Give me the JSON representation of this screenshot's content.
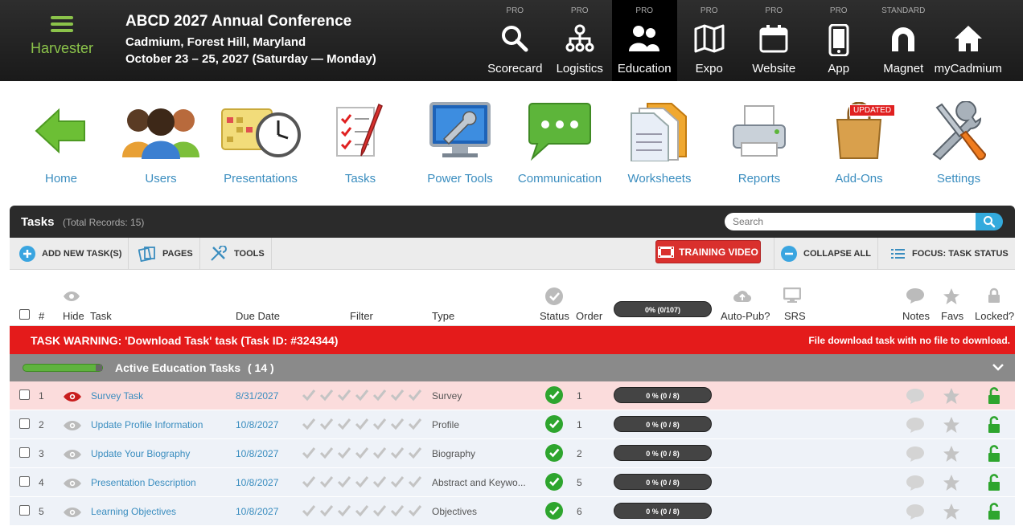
{
  "brand": {
    "name": "Harvester"
  },
  "conference": {
    "title": "ABCD 2027 Annual Conference",
    "location": "Cadmium, Forest Hill, Maryland",
    "dates": "October 23 – 25, 2027 (Saturday — Monday)"
  },
  "modules": [
    {
      "tier": "PRO",
      "label": "Scorecard",
      "icon": "magnifier-icon"
    },
    {
      "tier": "PRO",
      "label": "Logistics",
      "icon": "network-icon"
    },
    {
      "tier": "PRO",
      "label": "Education",
      "icon": "people-icon",
      "active": true
    },
    {
      "tier": "PRO",
      "label": "Expo",
      "icon": "map-icon"
    },
    {
      "tier": "PRO",
      "label": "Website",
      "icon": "calendar-icon"
    },
    {
      "tier": "PRO",
      "label": "App",
      "icon": "phone-icon"
    },
    {
      "tier": "STANDARD",
      "label": "Magnet",
      "icon": "magnet-icon"
    },
    {
      "tier": "",
      "label": "myCadmium",
      "icon": "home-icon"
    }
  ],
  "tools": [
    {
      "label": "Home",
      "icon": "home-arrow-icon"
    },
    {
      "label": "Users",
      "icon": "users-icon"
    },
    {
      "label": "Presentations",
      "icon": "presentations-icon"
    },
    {
      "label": "Tasks",
      "icon": "tasks-icon"
    },
    {
      "label": "Power Tools",
      "icon": "power-tools-icon"
    },
    {
      "label": "Communication",
      "icon": "chat-bubble-icon"
    },
    {
      "label": "Worksheets",
      "icon": "worksheets-icon"
    },
    {
      "label": "Reports",
      "icon": "printer-icon"
    },
    {
      "label": "Add-Ons",
      "icon": "shopping-bag-icon",
      "badge": "UPDATED"
    },
    {
      "label": "Settings",
      "icon": "wrench-screwdriver-icon"
    }
  ],
  "panel": {
    "title": "Tasks",
    "count": "(Total Records: 15)",
    "search_placeholder": "Search"
  },
  "actions": {
    "add": "ADD NEW TASK(S)",
    "pages": "PAGES",
    "tools": "TOOLS",
    "training": "TRAINING VIDEO",
    "collapse": "COLLAPSE ALL",
    "focus": "FOCUS: TASK STATUS"
  },
  "columns": {
    "num": "#",
    "hide": "Hide",
    "task": "Task",
    "due": "Due Date",
    "filter": "Filter",
    "type": "Type",
    "status": "Status",
    "order": "Order",
    "progress": "0% (0/107)",
    "autopub": "Auto-Pub?",
    "srs": "SRS",
    "notes": "Notes",
    "favs": "Favs",
    "locked": "Locked?"
  },
  "warning": {
    "left": "TASK WARNING: 'Download Task' task (Task ID: #324344)",
    "right": "File download task with no file to download."
  },
  "group": {
    "label": "Active Education Tasks",
    "count": "( 14 )",
    "progress": 0.95
  },
  "rows": [
    {
      "num": "1",
      "task": "Survey Task",
      "due": "8/31/2027",
      "type": "Survey",
      "order": "1",
      "progress": "0 % (0 / 8)",
      "hidden": true
    },
    {
      "num": "2",
      "task": "Update Profile Information",
      "due": "10/8/2027",
      "type": "Profile",
      "order": "1",
      "progress": "0 % (0 / 8)"
    },
    {
      "num": "3",
      "task": "Update Your Biography",
      "due": "10/8/2027",
      "type": "Biography",
      "order": "2",
      "progress": "0 % (0 / 8)"
    },
    {
      "num": "4",
      "task": "Presentation Description",
      "due": "10/8/2027",
      "type": "Abstract and Keywo...",
      "order": "5",
      "progress": "0 % (0 / 8)"
    },
    {
      "num": "5",
      "task": "Learning Objectives",
      "due": "10/8/2027",
      "type": "Objectives",
      "order": "6",
      "progress": "0 % (0 / 8)"
    }
  ]
}
